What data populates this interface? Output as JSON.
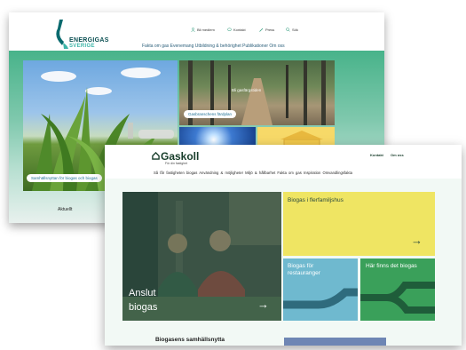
{
  "back_site": {
    "brand_line1": "ENERGIGAS",
    "brand_line2": "SVERIGE",
    "utility_links": [
      "Bli medlem",
      "Kontakt",
      "Press",
      "Sök"
    ],
    "nav": "Fakta om gas   Evenemang   Utbildning & behörighet   Publikationer   Om oss",
    "tags": {
      "roadmap": "Gasbranschens färdplan",
      "gasfair": "Bli gasfärgstiden",
      "biogas": "Samhällsnyttan för biogas och biogas"
    },
    "aktuellt": "Aktuellt"
  },
  "front_site": {
    "brand": "Gaskoll",
    "brand_sub": "För din fastighet",
    "top_links": [
      "Kontakt",
      "Om oss"
    ],
    "nav": "Så får fastigheten biogas   Användning & möjligheter   Miljö & hållbarhet   Fakta om gas   Inspiration   Omvandlingsfakta",
    "tile_yellow": "Biogas i flerfamiljshus",
    "tile_blue_line1": "Biogas för",
    "tile_blue_line2": "restauranger",
    "tile_green": "Här finns det biogas",
    "photo_title_line1": "Anslut",
    "photo_title_line2": "biogas",
    "arrow": "→",
    "section_heading": "Biogasens samhällsnytta"
  },
  "colors": {
    "energigas_green": "#48b38a",
    "gaskoll_yellow": "#efe563",
    "gaskoll_blue": "#6fb9cf",
    "gaskoll_green": "#3aa05a"
  }
}
